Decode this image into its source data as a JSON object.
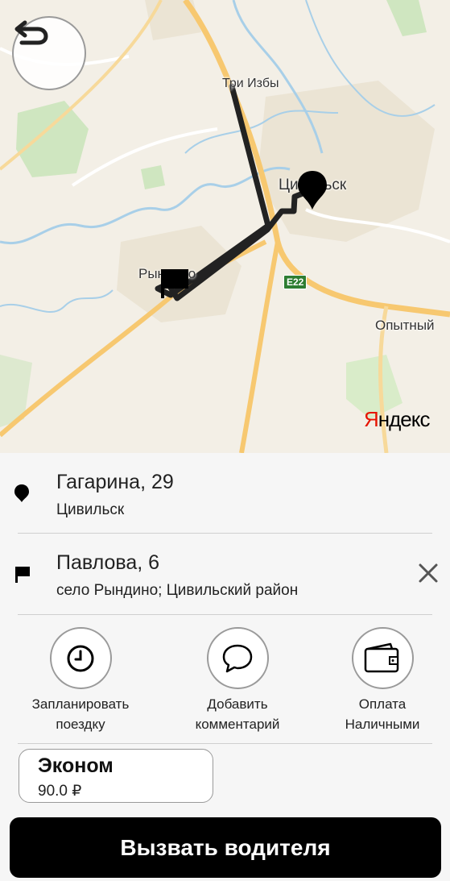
{
  "map": {
    "towns": {
      "tri_izby": "Три Избы",
      "tsivilsk": "Цивильск",
      "ryndino": "Рындино",
      "opytny": "Опытный"
    },
    "road_shield": "E22",
    "brand_ya": "Я",
    "brand_rest": "ндекс",
    "icons": {
      "back": "undo-arrow-icon",
      "start": "map-pin-icon",
      "finish": "flag-icon"
    }
  },
  "route": {
    "from": {
      "main": "Гагарина, 29",
      "sub": "Цивильск"
    },
    "to": {
      "main": "Павлова, 6",
      "sub": "село Рындино; Цивильский район"
    }
  },
  "options": [
    {
      "line1": "Запланировать",
      "line2": "поездку",
      "icon": "clock-icon"
    },
    {
      "line1": "Добавить",
      "line2": "комментарий",
      "icon": "chat-bubble-icon"
    },
    {
      "line1": "Оплата",
      "line2": "Наличными",
      "icon": "wallet-icon"
    }
  ],
  "tariff": {
    "name": "Эконом",
    "price": "90.0 ₽"
  },
  "call_button": "Вызвать водителя",
  "colors": {
    "route": "#222222",
    "button": "#000000",
    "yandex_red": "#e61400",
    "road": "#f7c870"
  }
}
